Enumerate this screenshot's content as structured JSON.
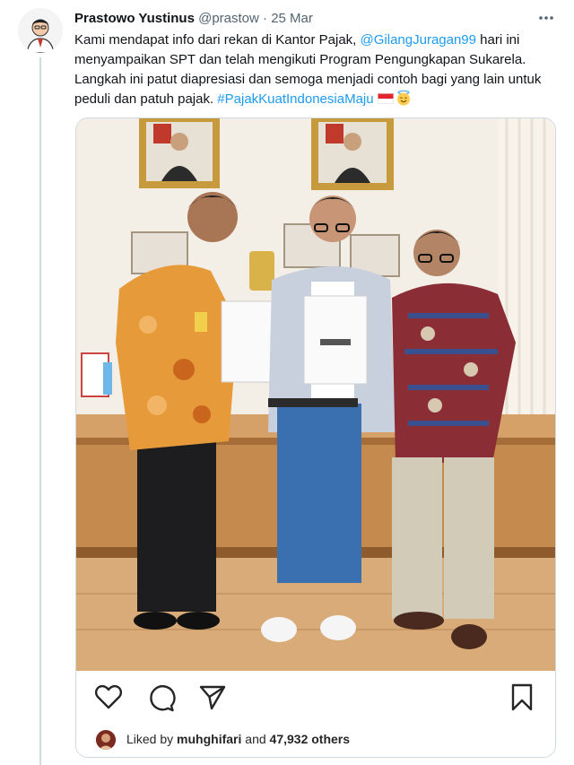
{
  "tweet": {
    "author_name": "Prastowo Yustinus",
    "author_handle": "@prastow",
    "separator": "·",
    "date": "25 Mar",
    "text_parts": {
      "p1": "Kami mendapat info dari rekan di Kantor Pajak, ",
      "mention": "@GilangJuragan99",
      "p2": " hari ini menyampaikan SPT dan telah mengikuti Program Pengungkapan Sukarela. Langkah ini patut diapresiasi dan semoga menjadi contoh bagi yang lain untuk peduli dan patuh pajak. ",
      "hashtag": "#PajakKuatIndonesiaMaju"
    },
    "icons": {
      "more": "more-horizontal-icon",
      "flag": "indonesia-flag-icon",
      "emoji": "smiling-halo-emoji-icon"
    }
  },
  "embedded_post": {
    "photo_icon": "photo-image",
    "actions": [
      "heart-icon",
      "comment-icon",
      "share-send-icon",
      "bookmark-icon"
    ],
    "likes": {
      "prefix": "Liked by ",
      "user": "muhghifari",
      "middle": " and ",
      "count": "47,932 others"
    }
  },
  "colors": {
    "link": "#1d9bf0",
    "text": "#0f1419",
    "muted": "#536471",
    "border": "#cfd9de"
  }
}
